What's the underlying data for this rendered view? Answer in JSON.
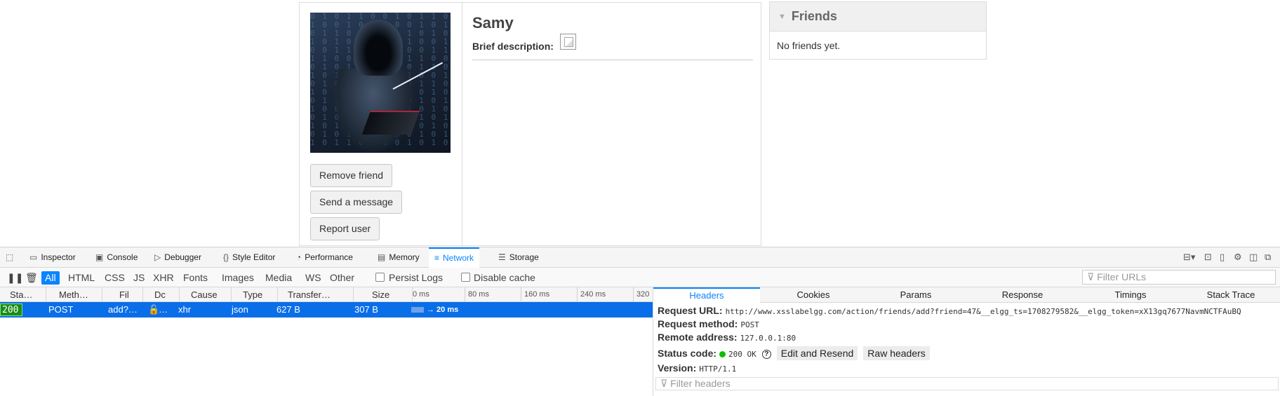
{
  "profile": {
    "name": "Samy",
    "brief_label": "Brief description:",
    "buttons": {
      "remove": "Remove friend",
      "message": "Send a message",
      "report": "Report user"
    }
  },
  "friends": {
    "title": "Friends",
    "empty": "No friends yet."
  },
  "devtools": {
    "tabs": [
      "Inspector",
      "Console",
      "Debugger",
      "Style Editor",
      "Performance",
      "Memory",
      "Network",
      "Storage"
    ],
    "active_tab": "Network",
    "toolbar": {
      "filters": [
        "All",
        "HTML",
        "CSS",
        "JS",
        "XHR",
        "Fonts",
        "Images",
        "Media",
        "WS",
        "Other"
      ],
      "persist_logs": "Persist Logs",
      "disable_cache": "Disable cache",
      "filter_urls_placeholder": "Filter URLs"
    },
    "columns": [
      "Sta…",
      "Meth…",
      "Fil",
      "Dc",
      "Cause",
      "Type",
      "Transfer…",
      "Size"
    ],
    "timeline_ticks": [
      "0 ms",
      "80 ms",
      "160 ms",
      "240 ms",
      "320"
    ],
    "request": {
      "status": "200",
      "method": "POST",
      "file": "add?…",
      "domain": "…",
      "cause": "xhr",
      "type": "json",
      "transferred": "627 B",
      "size": "307 B",
      "waterfall_label": "→ 20 ms"
    },
    "detail_tabs": [
      "Headers",
      "Cookies",
      "Params",
      "Response",
      "Timings",
      "Stack Trace"
    ],
    "headers": {
      "request_url_label": "Request URL:",
      "request_url": "http://www.xsslabelgg.com/action/friends/add?friend=47&__elgg_ts=1708279582&__elgg_token=xX13gq7677NavmNCTFAuBQ",
      "method_label": "Request method:",
      "method": "POST",
      "remote_label": "Remote address:",
      "remote": "127.0.0.1:80",
      "status_label": "Status code:",
      "status": "200 OK",
      "edit_resend": "Edit and Resend",
      "raw_headers": "Raw headers",
      "version_label": "Version:",
      "version": "HTTP/1.1",
      "filter_placeholder": "Filter headers"
    }
  }
}
